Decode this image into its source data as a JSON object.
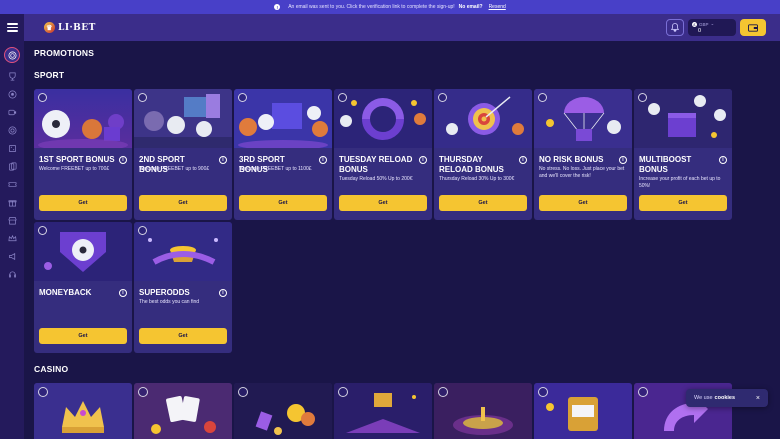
{
  "notice": {
    "text": "An email was sent to you. Click the verification link to complete the sign-up!",
    "bold": "No email?",
    "link": "Resend"
  },
  "header": {
    "logo": "LI·BET",
    "balance_currency": "GBP",
    "balance_amount": "0"
  },
  "sections": {
    "promotions": "PROMOTIONS",
    "sport": "SPORT",
    "casino": "CASINO"
  },
  "cards": [
    {
      "title": "1ST SPORT BONUS",
      "desc": "Welcome FREEBET up to 700£",
      "button": "Get"
    },
    {
      "title": "2ND SPORT BONUS",
      "desc": "Welcome FREEBET up to 900£",
      "button": "Get"
    },
    {
      "title": "3RD SPORT BONUS",
      "desc": "Welcome FREEBET up to 1100£",
      "button": "Get"
    },
    {
      "title": "TUESDAY RELOAD BONUS",
      "desc": "Tuesday Reload 50% Up to 200€",
      "button": "Get"
    },
    {
      "title": "THURSDAY RELOAD BONUS",
      "desc": "Thursday Reload 30% Up to 300€",
      "button": "Get"
    },
    {
      "title": "NO RISK BONUS",
      "desc": "No stress. No loss. Just place your bet and we'll cover the risk!",
      "button": "Get"
    },
    {
      "title": "MULTIBOOST BONUS",
      "desc": "Increase your profit of each bet up to 50%!",
      "button": "Get"
    },
    {
      "title": "MONEYBACK",
      "desc": "",
      "button": "Get"
    },
    {
      "title": "SUPERODDS",
      "desc": "The best odds you can find",
      "button": "Get"
    }
  ],
  "cookie": {
    "text": "We use",
    "link": "cookies",
    "close": "×"
  }
}
